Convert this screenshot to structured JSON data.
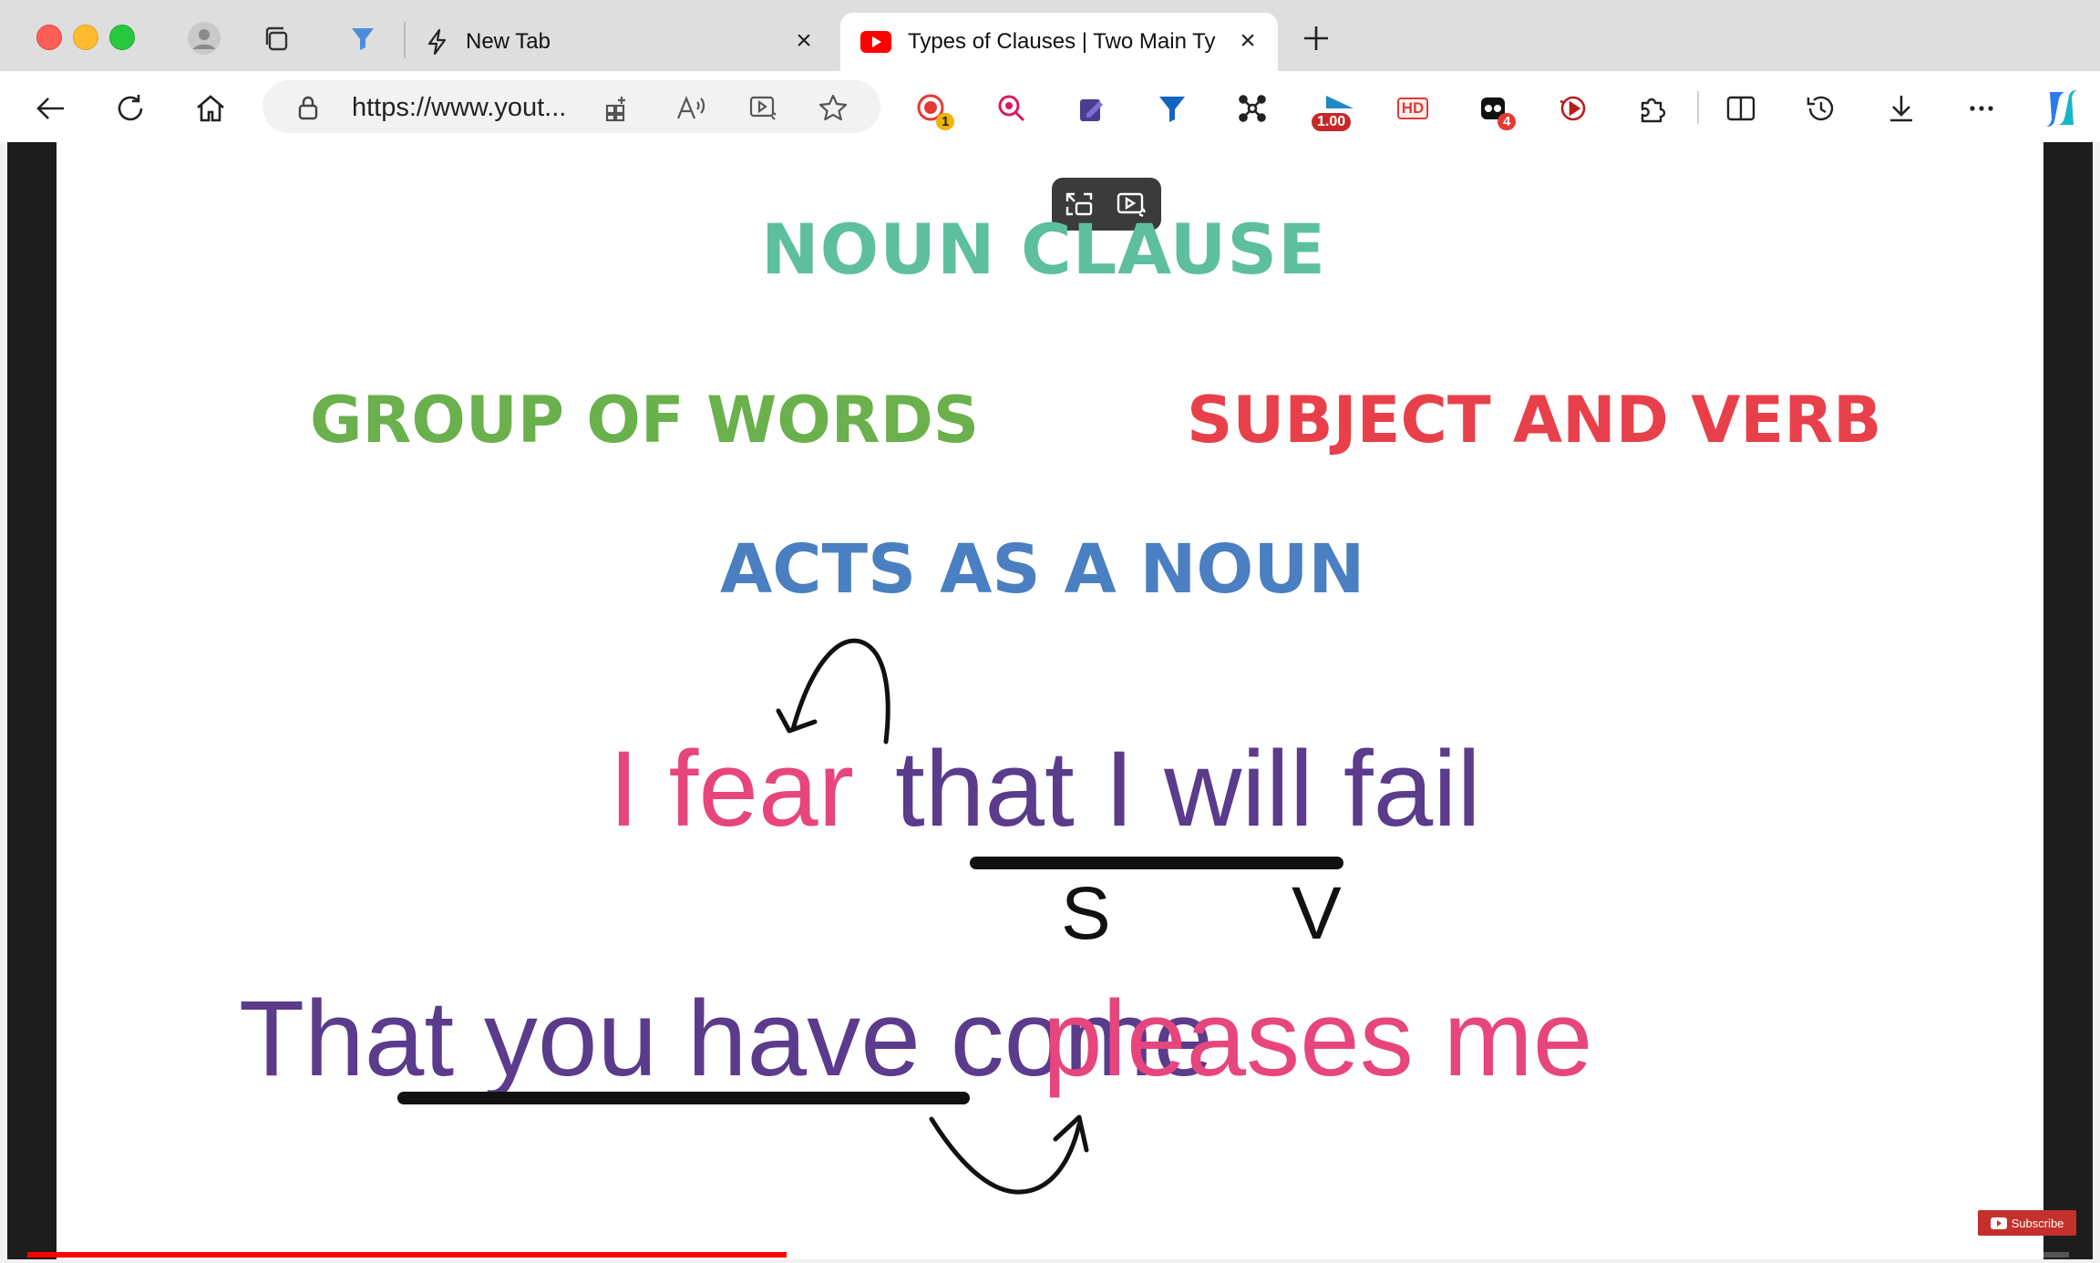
{
  "window": {
    "tabs": [
      {
        "title": "New Tab",
        "active": false
      },
      {
        "title": "Types of Clauses | Two Main Ty",
        "active": true
      }
    ]
  },
  "toolbar": {
    "url": "https://www.yout...",
    "extensions": [
      {
        "icon": "record-icon",
        "badge": "1"
      },
      {
        "icon": "zoom-search-icon"
      },
      {
        "icon": "edit-note-icon"
      },
      {
        "icon": "funnel-icon"
      },
      {
        "icon": "network-icon"
      },
      {
        "icon": "playback-speed-icon",
        "badge": "1.00"
      },
      {
        "icon": "hd-icon",
        "label": "HD"
      },
      {
        "icon": "ghost-icon",
        "badge": "4"
      },
      {
        "icon": "video-capture-icon"
      },
      {
        "icon": "puzzle-icon"
      }
    ]
  },
  "video": {
    "title": "NOUN CLAUSE",
    "left_label": "GROUP OF WORDS",
    "right_label": "SUBJECT AND VERB",
    "middle_label": "ACTS AS A NOUN",
    "example1": {
      "main": "I fear",
      "clause": "that I will fail",
      "s": "S",
      "v": "V"
    },
    "example2": {
      "clause": "That you have come",
      "main": "pleases me"
    },
    "progress": 0.372,
    "subscribe": "Subscribe"
  },
  "colors": {
    "title": "#5dbf9f",
    "green": "#6ab04c",
    "red": "#e8404a",
    "blue": "#4a7fc1",
    "pink": "#e7457e",
    "purple": "#5a3b8c",
    "accent": "#ff0000"
  }
}
